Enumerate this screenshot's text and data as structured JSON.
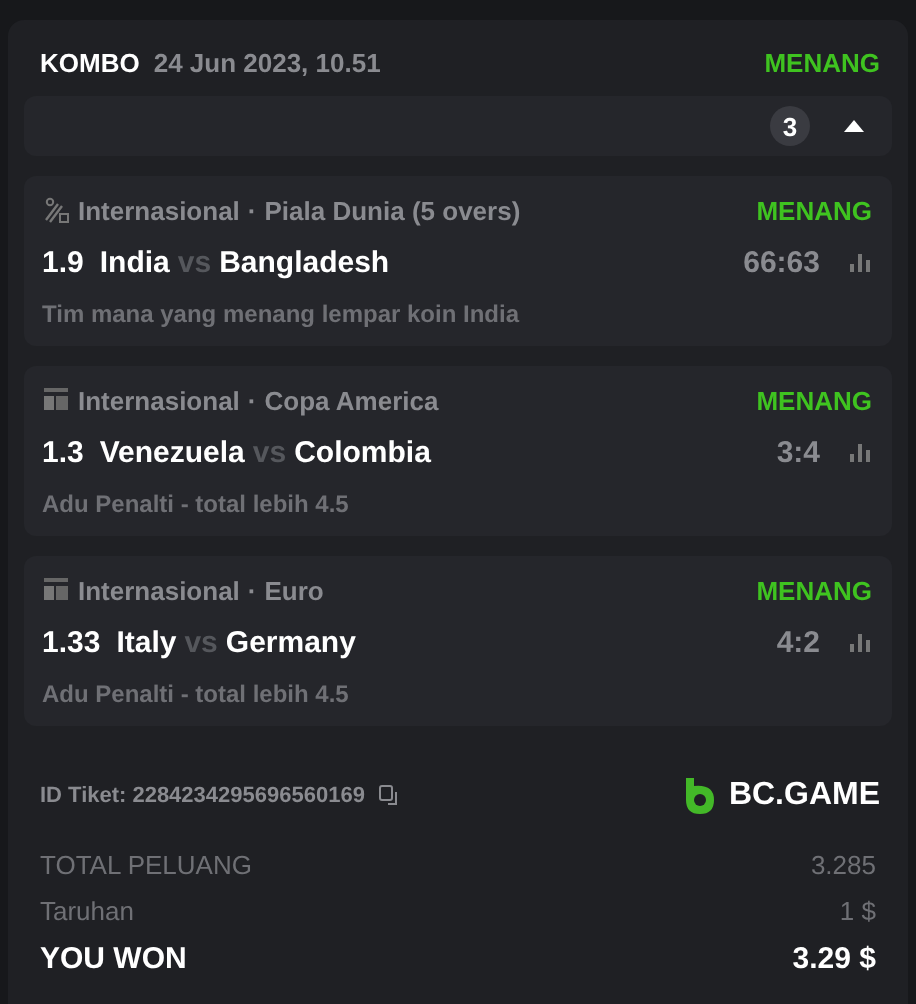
{
  "header": {
    "type": "KOMBO",
    "date": "24 Jun 2023, 10.51",
    "status": "MENANG"
  },
  "selections_count": "3",
  "expanded": true,
  "legs": [
    {
      "kind": "cricket",
      "category": "Internasional",
      "separator": "·",
      "competition": "Piala Dunia (5 overs)",
      "status": "MENANG",
      "odds": "1.9",
      "home": "India",
      "vs": "vs",
      "away": "Bangladesh",
      "score": "66:63",
      "market": "Tim mana yang menang lempar koin India"
    },
    {
      "kind": "fifa",
      "category": "Internasional",
      "separator": "·",
      "competition": "Copa America",
      "status": "MENANG",
      "odds": "1.3",
      "home": "Venezuela",
      "vs": "vs",
      "away": "Colombia",
      "score": "3:4",
      "market": "Adu Penalti - total lebih 4.5"
    },
    {
      "kind": "fifa",
      "category": "Internasional",
      "separator": "·",
      "competition": "Euro",
      "status": "MENANG",
      "odds": "1.33",
      "home": "Italy",
      "vs": "vs",
      "away": "Germany",
      "score": "4:2",
      "market": "Adu Penalti - total lebih 4.5"
    }
  ],
  "ticket": {
    "label": "ID Tiket:",
    "id": "2284234295696560169"
  },
  "brand": "BC.GAME",
  "summary": [
    {
      "kind": "plain",
      "label": "TOTAL PELUANG",
      "value": "3.285"
    },
    {
      "kind": "plain",
      "label": "Taruhan",
      "value": "1 $"
    },
    {
      "kind": "total",
      "label": "YOU WON",
      "value": "3.29 $"
    }
  ]
}
